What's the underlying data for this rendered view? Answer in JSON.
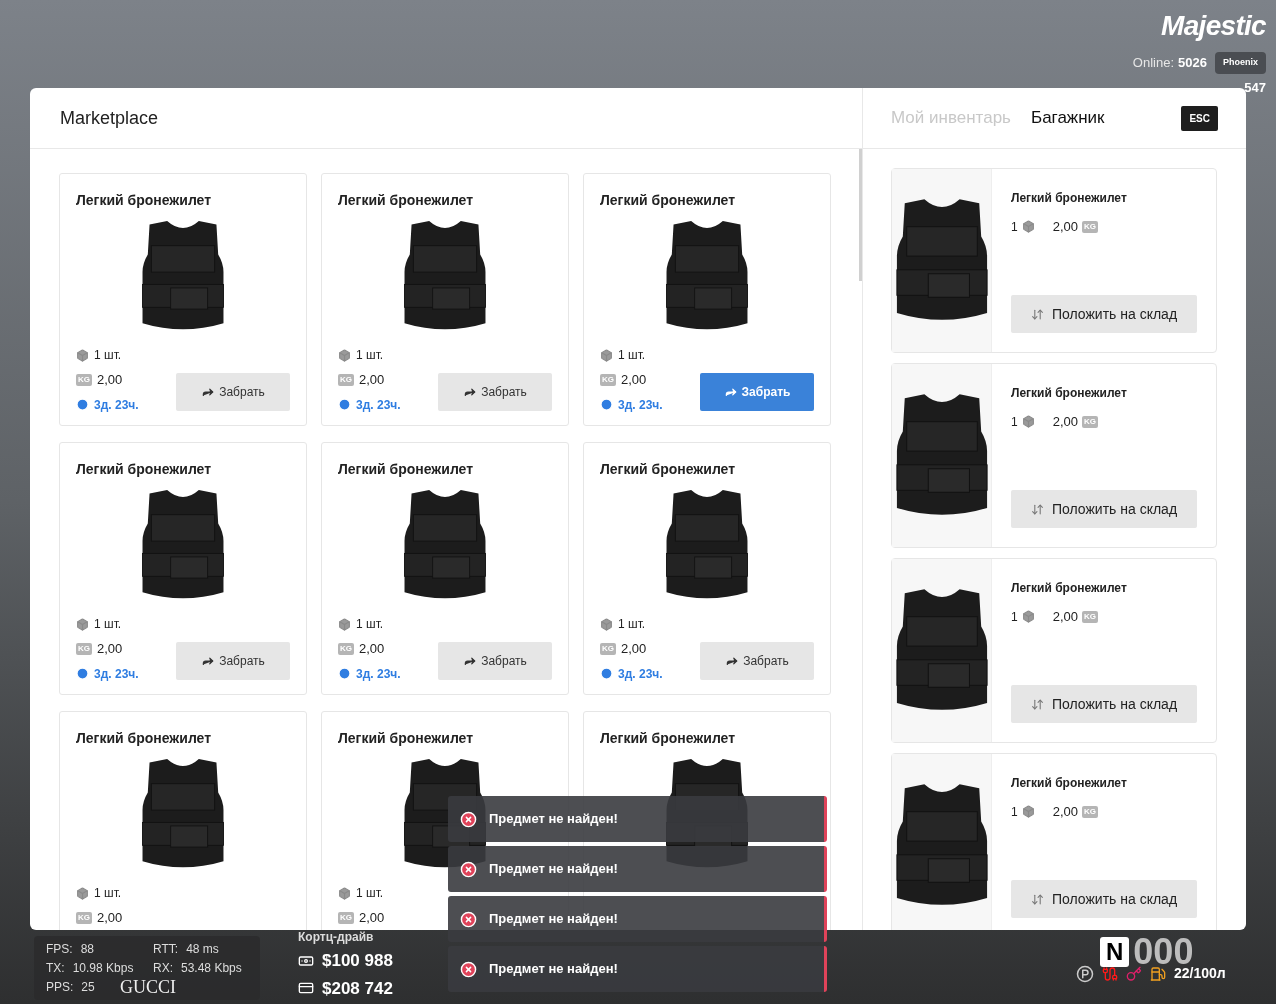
{
  "header": {
    "logo": "Majestic",
    "online_label": "Online:",
    "online_count": "5026",
    "server": "Phoenix",
    "player_id": "547"
  },
  "marketplace": {
    "title": "Marketplace",
    "close_key": "ESC",
    "tabs": [
      {
        "label": "Мой инвентарь",
        "selected": false
      },
      {
        "label": "Багажник",
        "selected": true
      }
    ],
    "listings": [
      {
        "title": "Легкий бронежилет",
        "quantity": "1 шт.",
        "weight": "2,00",
        "unit": "KG",
        "time": "3д. 23ч.",
        "button": "Забрать",
        "highlighted": false
      },
      {
        "title": "Легкий бронежилет",
        "quantity": "1 шт.",
        "weight": "2,00",
        "unit": "KG",
        "time": "3д. 23ч.",
        "button": "Забрать",
        "highlighted": false
      },
      {
        "title": "Легкий бронежилет",
        "quantity": "1 шт.",
        "weight": "2,00",
        "unit": "KG",
        "time": "3д. 23ч.",
        "button": "Забрать",
        "highlighted": true
      },
      {
        "title": "Легкий бронежилет",
        "quantity": "1 шт.",
        "weight": "2,00",
        "unit": "KG",
        "time": "3д. 23ч.",
        "button": "Забрать",
        "highlighted": false
      },
      {
        "title": "Легкий бронежилет",
        "quantity": "1 шт.",
        "weight": "2,00",
        "unit": "KG",
        "time": "3д. 23ч.",
        "button": "Забрать",
        "highlighted": false
      },
      {
        "title": "Легкий бронежилет",
        "quantity": "1 шт.",
        "weight": "2,00",
        "unit": "KG",
        "time": "3д. 23ч.",
        "button": "Забрать",
        "highlighted": false
      },
      {
        "title": "Легкий бронежилет",
        "quantity": "1 шт.",
        "weight": "2,00",
        "unit": "KG"
      },
      {
        "title": "Легкий бронежилет",
        "quantity": "1 шт.",
        "weight": "2,00",
        "unit": "KG"
      },
      {
        "title": "Легкий бронежилет"
      }
    ],
    "storage_items": [
      {
        "title": "Легкий бронежилет",
        "count": "1",
        "weight": "2,00",
        "unit": "KG",
        "button": "Положить на склад"
      },
      {
        "title": "Легкий бронежилет",
        "count": "1",
        "weight": "2,00",
        "unit": "KG",
        "button": "Положить на склад"
      },
      {
        "title": "Легкий бронежилет",
        "count": "1",
        "weight": "2,00",
        "unit": "KG",
        "button": "Положить на склад"
      },
      {
        "title": "Легкий бронежилет",
        "count": "1",
        "weight": "2,00",
        "unit": "KG",
        "button": "Положить на склад"
      }
    ]
  },
  "notifications": [
    {
      "text": "Предмет не найден!"
    },
    {
      "text": "Предмет не найден!"
    },
    {
      "text": "Предмет не найден!"
    },
    {
      "text": "Предмет не найден!"
    }
  ],
  "net_stats": [
    {
      "label": "FPS:",
      "value": "88"
    },
    {
      "label": "RTT:",
      "value": "48 ms"
    },
    {
      "label": "TX:",
      "value": "10.98 Kbps"
    },
    {
      "label": "RX:",
      "value": "53.48 Kbps"
    },
    {
      "label": "PPS:",
      "value": "25"
    }
  ],
  "brand": "GUCCI",
  "wallet": {
    "location": "Кортц-драйв",
    "cash": "$100 988",
    "bank": "$208 742"
  },
  "vehicle": {
    "gear": "N",
    "speed": "000",
    "fuel": "22/100л"
  }
}
